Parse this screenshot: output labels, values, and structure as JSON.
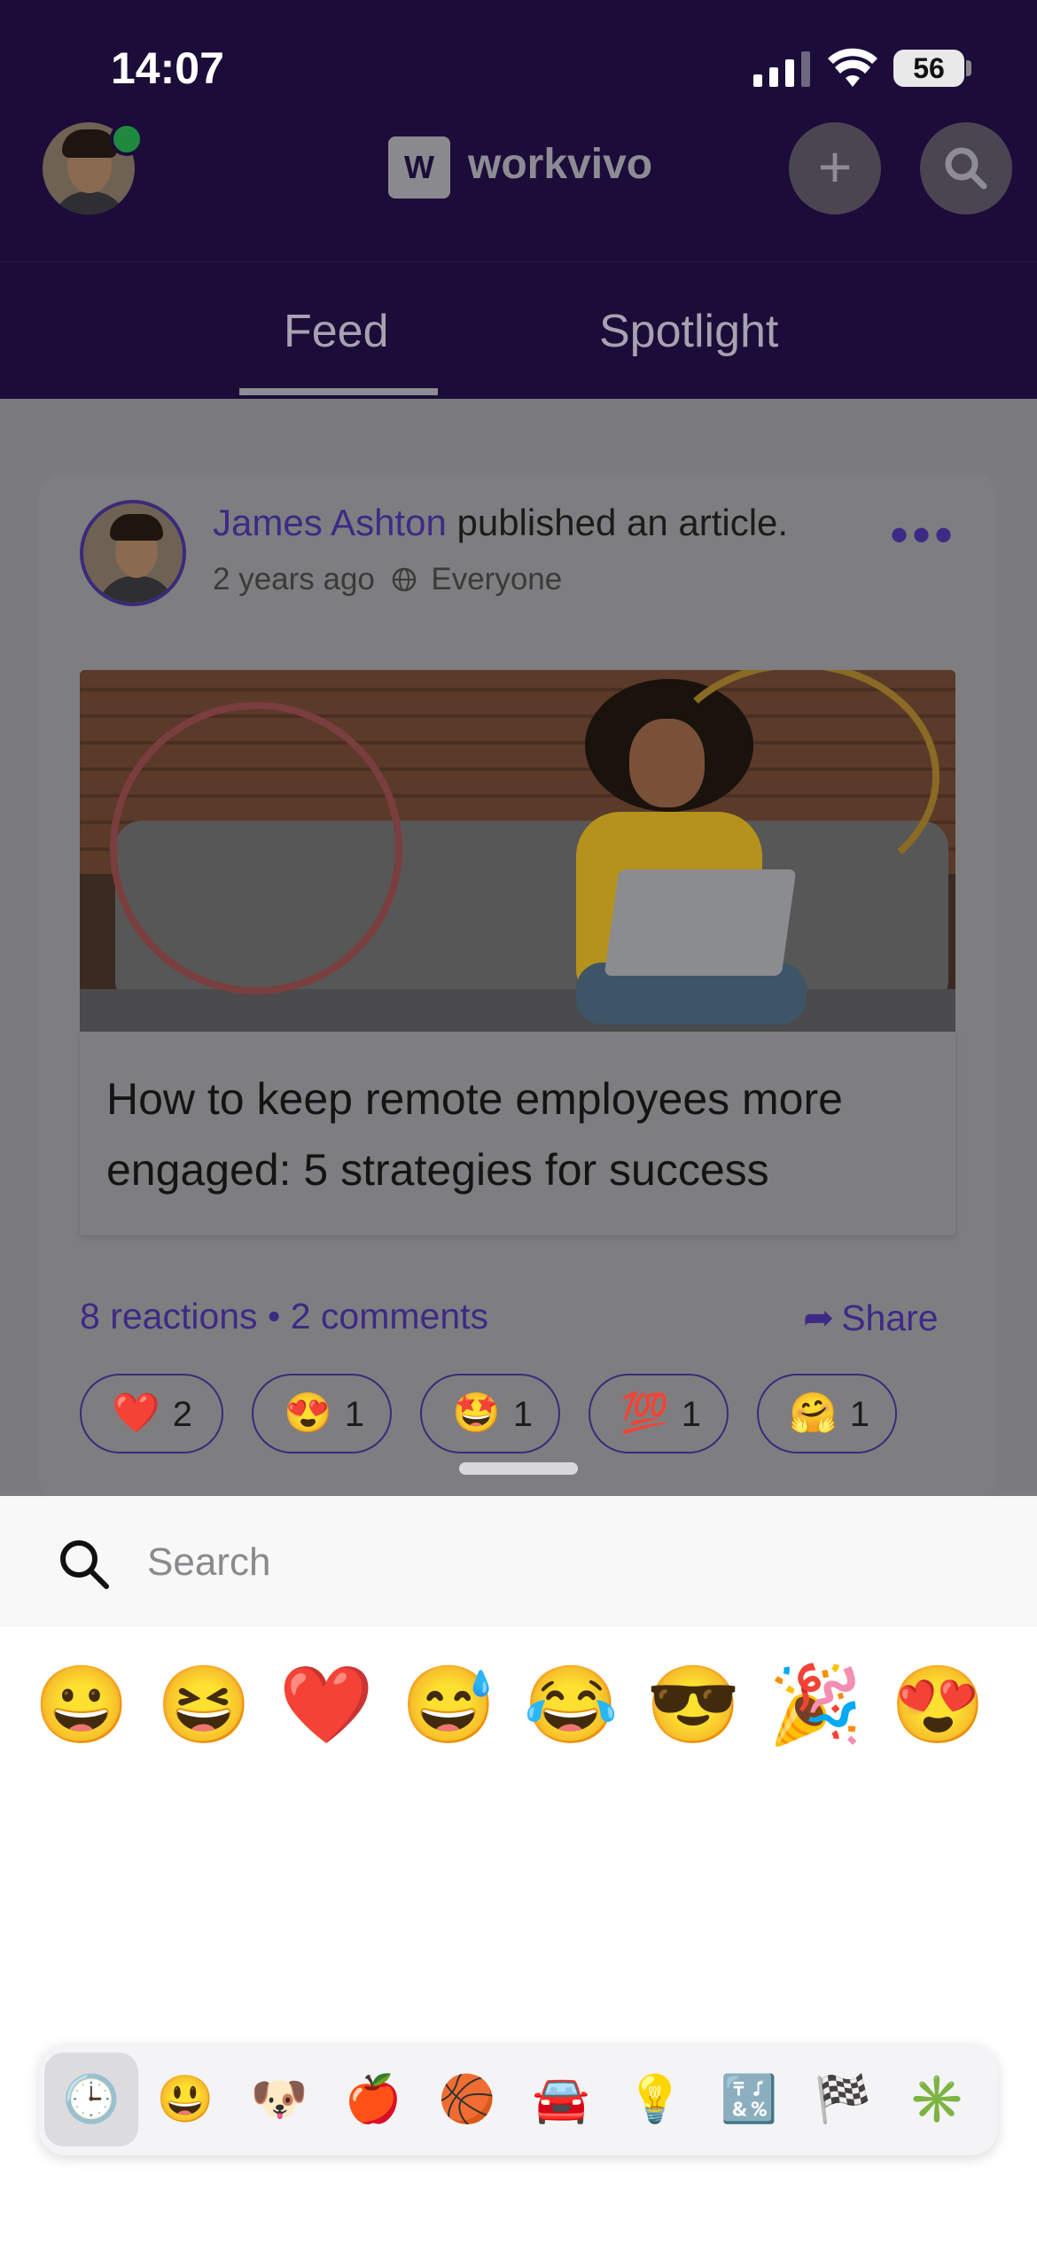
{
  "status_bar": {
    "time": "14:07",
    "battery": "56",
    "icons": [
      "signal-icon",
      "wifi-icon",
      "battery-icon"
    ]
  },
  "header": {
    "logo_mark": "W",
    "logo_text": "workvivo",
    "plus_icon": "plus-icon",
    "search_icon": "search-icon",
    "online_status_color": "#1f8a3f"
  },
  "tabs": [
    {
      "label": "Feed",
      "active": true
    },
    {
      "label": "Spotlight",
      "active": false
    }
  ],
  "post": {
    "author": "James Ashton",
    "action": "published an article.",
    "time": "2 years ago",
    "audience": "Everyone",
    "article_title": "How to keep remote employees more engaged: 5 strategies for success",
    "reactions_text": "8 reactions",
    "separator": "•",
    "comments_text": "2 comments",
    "share_label": "Share",
    "accent_color": "#3d2a85",
    "reaction_chips": [
      {
        "emoji": "❤️",
        "count": "2"
      },
      {
        "emoji": "😍",
        "count": "1"
      },
      {
        "emoji": "🤩",
        "count": "1"
      },
      {
        "emoji": "💯",
        "count": "1"
      },
      {
        "emoji": "🤗",
        "count": "1"
      }
    ]
  },
  "emoji_picker": {
    "search_placeholder": "Search",
    "recent": [
      "😀",
      "😆",
      "❤️",
      "😅",
      "😂",
      "😎",
      "🎉",
      "😍"
    ],
    "categories": [
      {
        "icon": "🕒",
        "name": "recent",
        "active": true
      },
      {
        "icon": "😃",
        "name": "smileys"
      },
      {
        "icon": "🐶",
        "name": "animals"
      },
      {
        "icon": "🍎",
        "name": "food"
      },
      {
        "icon": "🏀",
        "name": "activity"
      },
      {
        "icon": "🚘",
        "name": "travel"
      },
      {
        "icon": "💡",
        "name": "objects"
      },
      {
        "icon": "🔣",
        "name": "symbols"
      },
      {
        "icon": "🏁",
        "name": "flags"
      },
      {
        "icon": "✳️",
        "name": "other"
      }
    ]
  }
}
